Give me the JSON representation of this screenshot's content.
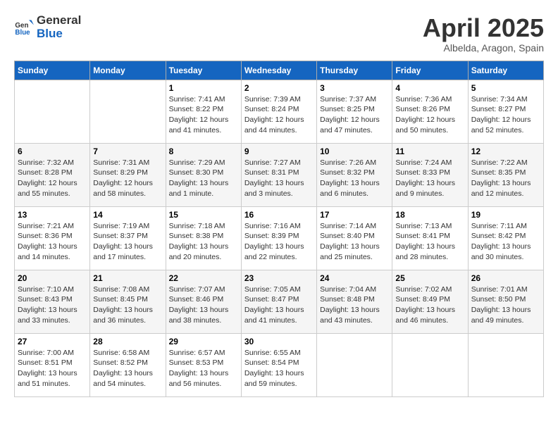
{
  "header": {
    "logo_general": "General",
    "logo_blue": "Blue",
    "title": "April 2025",
    "subtitle": "Albelda, Aragon, Spain"
  },
  "days_of_week": [
    "Sunday",
    "Monday",
    "Tuesday",
    "Wednesday",
    "Thursday",
    "Friday",
    "Saturday"
  ],
  "weeks": [
    [
      {
        "day": "",
        "content": ""
      },
      {
        "day": "",
        "content": ""
      },
      {
        "day": "1",
        "content": "Sunrise: 7:41 AM\nSunset: 8:22 PM\nDaylight: 12 hours and 41 minutes."
      },
      {
        "day": "2",
        "content": "Sunrise: 7:39 AM\nSunset: 8:24 PM\nDaylight: 12 hours and 44 minutes."
      },
      {
        "day": "3",
        "content": "Sunrise: 7:37 AM\nSunset: 8:25 PM\nDaylight: 12 hours and 47 minutes."
      },
      {
        "day": "4",
        "content": "Sunrise: 7:36 AM\nSunset: 8:26 PM\nDaylight: 12 hours and 50 minutes."
      },
      {
        "day": "5",
        "content": "Sunrise: 7:34 AM\nSunset: 8:27 PM\nDaylight: 12 hours and 52 minutes."
      }
    ],
    [
      {
        "day": "6",
        "content": "Sunrise: 7:32 AM\nSunset: 8:28 PM\nDaylight: 12 hours and 55 minutes."
      },
      {
        "day": "7",
        "content": "Sunrise: 7:31 AM\nSunset: 8:29 PM\nDaylight: 12 hours and 58 minutes."
      },
      {
        "day": "8",
        "content": "Sunrise: 7:29 AM\nSunset: 8:30 PM\nDaylight: 13 hours and 1 minute."
      },
      {
        "day": "9",
        "content": "Sunrise: 7:27 AM\nSunset: 8:31 PM\nDaylight: 13 hours and 3 minutes."
      },
      {
        "day": "10",
        "content": "Sunrise: 7:26 AM\nSunset: 8:32 PM\nDaylight: 13 hours and 6 minutes."
      },
      {
        "day": "11",
        "content": "Sunrise: 7:24 AM\nSunset: 8:33 PM\nDaylight: 13 hours and 9 minutes."
      },
      {
        "day": "12",
        "content": "Sunrise: 7:22 AM\nSunset: 8:35 PM\nDaylight: 13 hours and 12 minutes."
      }
    ],
    [
      {
        "day": "13",
        "content": "Sunrise: 7:21 AM\nSunset: 8:36 PM\nDaylight: 13 hours and 14 minutes."
      },
      {
        "day": "14",
        "content": "Sunrise: 7:19 AM\nSunset: 8:37 PM\nDaylight: 13 hours and 17 minutes."
      },
      {
        "day": "15",
        "content": "Sunrise: 7:18 AM\nSunset: 8:38 PM\nDaylight: 13 hours and 20 minutes."
      },
      {
        "day": "16",
        "content": "Sunrise: 7:16 AM\nSunset: 8:39 PM\nDaylight: 13 hours and 22 minutes."
      },
      {
        "day": "17",
        "content": "Sunrise: 7:14 AM\nSunset: 8:40 PM\nDaylight: 13 hours and 25 minutes."
      },
      {
        "day": "18",
        "content": "Sunrise: 7:13 AM\nSunset: 8:41 PM\nDaylight: 13 hours and 28 minutes."
      },
      {
        "day": "19",
        "content": "Sunrise: 7:11 AM\nSunset: 8:42 PM\nDaylight: 13 hours and 30 minutes."
      }
    ],
    [
      {
        "day": "20",
        "content": "Sunrise: 7:10 AM\nSunset: 8:43 PM\nDaylight: 13 hours and 33 minutes."
      },
      {
        "day": "21",
        "content": "Sunrise: 7:08 AM\nSunset: 8:45 PM\nDaylight: 13 hours and 36 minutes."
      },
      {
        "day": "22",
        "content": "Sunrise: 7:07 AM\nSunset: 8:46 PM\nDaylight: 13 hours and 38 minutes."
      },
      {
        "day": "23",
        "content": "Sunrise: 7:05 AM\nSunset: 8:47 PM\nDaylight: 13 hours and 41 minutes."
      },
      {
        "day": "24",
        "content": "Sunrise: 7:04 AM\nSunset: 8:48 PM\nDaylight: 13 hours and 43 minutes."
      },
      {
        "day": "25",
        "content": "Sunrise: 7:02 AM\nSunset: 8:49 PM\nDaylight: 13 hours and 46 minutes."
      },
      {
        "day": "26",
        "content": "Sunrise: 7:01 AM\nSunset: 8:50 PM\nDaylight: 13 hours and 49 minutes."
      }
    ],
    [
      {
        "day": "27",
        "content": "Sunrise: 7:00 AM\nSunset: 8:51 PM\nDaylight: 13 hours and 51 minutes."
      },
      {
        "day": "28",
        "content": "Sunrise: 6:58 AM\nSunset: 8:52 PM\nDaylight: 13 hours and 54 minutes."
      },
      {
        "day": "29",
        "content": "Sunrise: 6:57 AM\nSunset: 8:53 PM\nDaylight: 13 hours and 56 minutes."
      },
      {
        "day": "30",
        "content": "Sunrise: 6:55 AM\nSunset: 8:54 PM\nDaylight: 13 hours and 59 minutes."
      },
      {
        "day": "",
        "content": ""
      },
      {
        "day": "",
        "content": ""
      },
      {
        "day": "",
        "content": ""
      }
    ]
  ]
}
